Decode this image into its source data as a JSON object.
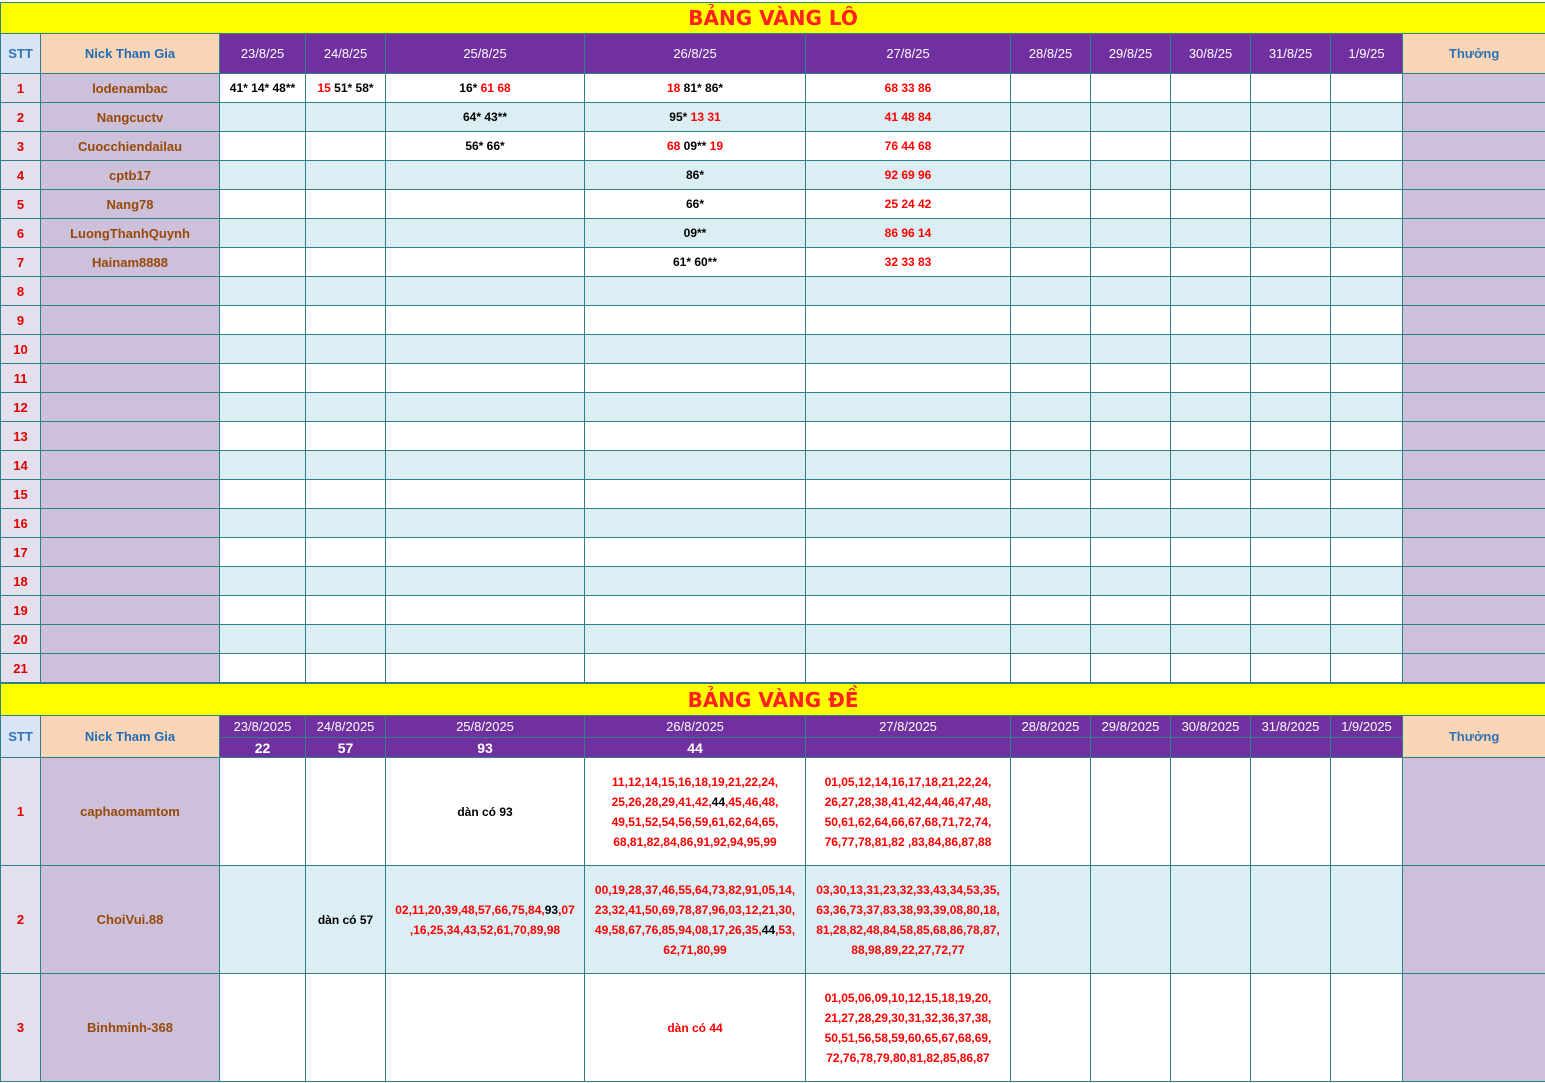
{
  "lo": {
    "title": "BẢNG VÀNG LÔ",
    "stt_header": "STT",
    "nick_header": "Nick Tham Gia",
    "reward_header": "Thưởng",
    "dates": [
      "23/8/25",
      "24/8/25",
      "25/8/25",
      "26/8/25",
      "27/8/25",
      "28/8/25",
      "29/8/25",
      "30/8/25",
      "31/8/25",
      "1/9/25"
    ],
    "rows": [
      {
        "stt": "1",
        "nick": "lodenambac",
        "cells": [
          [
            {
              "t": "41* 14* 48**",
              "c": "black"
            }
          ],
          [
            {
              "t": "15",
              "c": "red"
            },
            {
              "t": " 51* 58*",
              "c": "black"
            }
          ],
          [
            {
              "t": "16*",
              "c": "black"
            },
            {
              "t": " 61 68",
              "c": "red"
            }
          ],
          [
            {
              "t": "18",
              "c": "red"
            },
            {
              "t": " 81* 86*",
              "c": "black"
            }
          ],
          [
            {
              "t": "68 33 86",
              "c": "red"
            }
          ],
          [],
          [],
          [],
          [],
          []
        ]
      },
      {
        "stt": "2",
        "nick": "Nangcuctv",
        "cells": [
          [],
          [],
          [
            {
              "t": "64* 43**",
              "c": "black"
            }
          ],
          [
            {
              "t": "95*",
              "c": "black"
            },
            {
              "t": " 13 31",
              "c": "red"
            }
          ],
          [
            {
              "t": "41 48 84",
              "c": "red"
            }
          ],
          [],
          [],
          [],
          [],
          []
        ]
      },
      {
        "stt": "3",
        "nick": "Cuocchiendailau",
        "cells": [
          [],
          [],
          [
            {
              "t": "56* 66*",
              "c": "black"
            }
          ],
          [
            {
              "t": "68",
              "c": "red"
            },
            {
              "t": " 09** ",
              "c": "black"
            },
            {
              "t": "19",
              "c": "red"
            }
          ],
          [
            {
              "t": "76 44 68",
              "c": "red"
            }
          ],
          [],
          [],
          [],
          [],
          []
        ]
      },
      {
        "stt": "4",
        "nick": "cptb17",
        "cells": [
          [],
          [],
          [],
          [
            {
              "t": "86*",
              "c": "black"
            }
          ],
          [
            {
              "t": "92 69 96",
              "c": "red"
            }
          ],
          [],
          [],
          [],
          [],
          []
        ]
      },
      {
        "stt": "5",
        "nick": "Nang78",
        "cells": [
          [],
          [],
          [],
          [
            {
              "t": "66*",
              "c": "black"
            }
          ],
          [
            {
              "t": "25 24 42",
              "c": "red"
            }
          ],
          [],
          [],
          [],
          [],
          []
        ]
      },
      {
        "stt": "6",
        "nick": "LuongThanhQuynh",
        "cells": [
          [],
          [],
          [],
          [
            {
              "t": "09**",
              "c": "black"
            }
          ],
          [
            {
              "t": "86 96 14",
              "c": "red"
            }
          ],
          [],
          [],
          [],
          [],
          []
        ]
      },
      {
        "stt": "7",
        "nick": "Hainam8888",
        "cells": [
          [],
          [],
          [],
          [
            {
              "t": "61* 60**",
              "c": "black"
            }
          ],
          [
            {
              "t": "32 33 83",
              "c": "red"
            }
          ],
          [],
          [],
          [],
          [],
          []
        ]
      },
      {
        "stt": "8",
        "nick": "",
        "cells": [
          [],
          [],
          [],
          [],
          [],
          [],
          [],
          [],
          [],
          []
        ]
      },
      {
        "stt": "9",
        "nick": "",
        "cells": [
          [],
          [],
          [],
          [],
          [],
          [],
          [],
          [],
          [],
          []
        ]
      },
      {
        "stt": "10",
        "nick": "",
        "cells": [
          [],
          [],
          [],
          [],
          [],
          [],
          [],
          [],
          [],
          []
        ]
      },
      {
        "stt": "11",
        "nick": "",
        "cells": [
          [],
          [],
          [],
          [],
          [],
          [],
          [],
          [],
          [],
          []
        ]
      },
      {
        "stt": "12",
        "nick": "",
        "cells": [
          [],
          [],
          [],
          [],
          [],
          [],
          [],
          [],
          [],
          []
        ]
      },
      {
        "stt": "13",
        "nick": "",
        "cells": [
          [],
          [],
          [],
          [],
          [],
          [],
          [],
          [],
          [],
          []
        ]
      },
      {
        "stt": "14",
        "nick": "",
        "cells": [
          [],
          [],
          [],
          [],
          [],
          [],
          [],
          [],
          [],
          []
        ]
      },
      {
        "stt": "15",
        "nick": "",
        "cells": [
          [],
          [],
          [],
          [],
          [],
          [],
          [],
          [],
          [],
          []
        ]
      },
      {
        "stt": "16",
        "nick": "",
        "cells": [
          [],
          [],
          [],
          [],
          [],
          [],
          [],
          [],
          [],
          []
        ]
      },
      {
        "stt": "17",
        "nick": "",
        "cells": [
          [],
          [],
          [],
          [],
          [],
          [],
          [],
          [],
          [],
          []
        ]
      },
      {
        "stt": "18",
        "nick": "",
        "cells": [
          [],
          [],
          [],
          [],
          [],
          [],
          [],
          [],
          [],
          []
        ]
      },
      {
        "stt": "19",
        "nick": "",
        "cells": [
          [],
          [],
          [],
          [],
          [],
          [],
          [],
          [],
          [],
          []
        ]
      },
      {
        "stt": "20",
        "nick": "",
        "cells": [
          [],
          [],
          [],
          [],
          [],
          [],
          [],
          [],
          [],
          []
        ]
      },
      {
        "stt": "21",
        "nick": "",
        "cells": [
          [],
          [],
          [],
          [],
          [],
          [],
          [],
          [],
          [],
          []
        ]
      }
    ]
  },
  "de": {
    "title": "BẢNG VÀNG ĐỀ",
    "stt_header": "STT",
    "nick_header": "Nick Tham Gia",
    "reward_header": "Thưởng",
    "dates": [
      "23/8/2025",
      "24/8/2025",
      "25/8/2025",
      "26/8/2025",
      "27/8/2025",
      "28/8/2025",
      "29/8/2025",
      "30/8/2025",
      "31/8/2025",
      "1/9/2025"
    ],
    "results": [
      "22",
      "57",
      "93",
      "44",
      "",
      "",
      "",
      "",
      "",
      ""
    ],
    "rows": [
      {
        "stt": "1",
        "nick": "caphaomamtom",
        "cells": [
          [],
          [],
          [
            {
              "t": "dàn có 93",
              "c": "black"
            }
          ],
          [
            {
              "t": "11,12,14,15,16,18,19,21,22,24,\n25,26,28,29,41,42,",
              "c": "red"
            },
            {
              "t": "44",
              "c": "black"
            },
            {
              "t": ",45,46,48,\n49,51,52,54,56,59,61,62,64,65,\n68,81,82,84,86,91,92,94,95,99",
              "c": "red"
            }
          ],
          [
            {
              "t": "01,05,12,14,16,17,18,21,22,24,\n26,27,28,38,41,42,44,46,47,48,\n50,61,62,64,66,67,68,71,72,74,\n76,77,78,81,82 ,83,84,86,87,88",
              "c": "red"
            }
          ],
          [],
          [],
          [],
          [],
          []
        ]
      },
      {
        "stt": "2",
        "nick": "ChoiVui.88",
        "cells": [
          [],
          [
            {
              "t": "dàn có 57",
              "c": "black"
            }
          ],
          [
            {
              "t": "02,11,20,39,48,57,66,75,84,",
              "c": "red"
            },
            {
              "t": "93",
              "c": "black"
            },
            {
              "t": ",07\n,16,25,34,43,52,61,70,89,98",
              "c": "red"
            }
          ],
          [
            {
              "t": "00,19,28,37,46,55,64,73,82,91,05,14,\n23,32,41,50,69,78,87,96,03,12,21,30,\n49,58,67,76,85,94,08,17,26,35,",
              "c": "red"
            },
            {
              "t": "44",
              "c": "black"
            },
            {
              "t": ",53,\n62,71,80,99",
              "c": "red"
            }
          ],
          [
            {
              "t": "03,30,13,31,23,32,33,43,34,53,35,\n63,36,73,37,83,38,93,39,08,80,18,\n81,28,82,48,84,58,85,68,86,78,87,\n88,98,89,22,27,72,77",
              "c": "red"
            }
          ],
          [],
          [],
          [],
          [],
          []
        ]
      },
      {
        "stt": "3",
        "nick": "Binhminh-368",
        "cells": [
          [],
          [],
          [],
          [
            {
              "t": "dàn có 44",
              "c": "red"
            }
          ],
          [
            {
              "t": "01,05,06,09,10,12,15,18,19,20,\n21,27,28,29,30,31,32,36,37,38,\n50,51,56,58,59,60,65,67,68,69,\n72,76,78,79,80,81,82,85,86,87",
              "c": "red"
            }
          ],
          [],
          [],
          [],
          [],
          []
        ]
      }
    ]
  },
  "colors": {
    "title_bg": "#ffff00",
    "title_text": "#ff2020",
    "date_header_bg": "#7030a0",
    "nick_bg": "#ccc0da",
    "stt_bg": "#e4dfec",
    "alt_row_bg": "#daeef3",
    "grid": "#2e7f86"
  }
}
